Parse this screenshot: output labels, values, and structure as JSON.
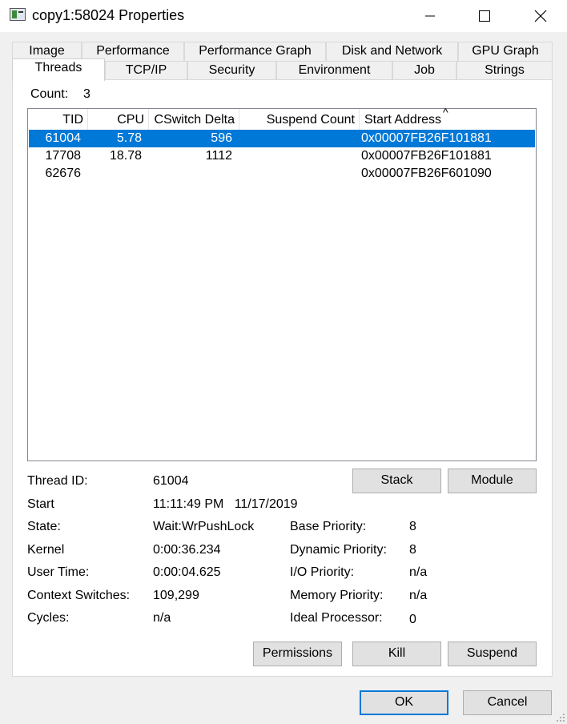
{
  "window": {
    "title": "copy1:58024 Properties"
  },
  "tabs_row1": [
    "Image",
    "Performance",
    "Performance Graph",
    "Disk and Network",
    "GPU Graph"
  ],
  "tabs_row2": [
    "Threads",
    "TCP/IP",
    "Security",
    "Environment",
    "Job",
    "Strings"
  ],
  "count": {
    "label": "Count:",
    "value": "3"
  },
  "threads": {
    "columns": [
      "TID",
      "CPU",
      "CSwitch Delta",
      "Suspend Count",
      "Start Address"
    ],
    "sort_indicator": "^",
    "rows": [
      {
        "tid": "61004",
        "cpu": "5.78",
        "cswitch": "596",
        "suspend": "",
        "start": "0x00007FB26F101881",
        "selected": true
      },
      {
        "tid": "17708",
        "cpu": "18.78",
        "cswitch": "1112",
        "suspend": "",
        "start": "0x00007FB26F101881",
        "selected": false
      },
      {
        "tid": "62676",
        "cpu": "",
        "cswitch": "",
        "suspend": "",
        "start": "0x00007FB26F601090",
        "selected": false
      }
    ]
  },
  "details": {
    "thread_id": {
      "label": "Thread ID:",
      "value": "61004"
    },
    "start": {
      "label": "Start",
      "value": "11:11:49 PM   11/17/2019"
    },
    "state": {
      "label": "State:",
      "value": "Wait:WrPushLock"
    },
    "kernel": {
      "label": "Kernel",
      "value": "0:00:36.234"
    },
    "user_time": {
      "label": "User Time:",
      "value": "0:00:04.625"
    },
    "context_switches": {
      "label": "Context Switches:",
      "value": "109,299"
    },
    "cycles": {
      "label": "Cycles:",
      "value": "n/a"
    },
    "base_priority": {
      "label": "Base Priority:",
      "value": "8"
    },
    "dynamic_priority": {
      "label": "Dynamic Priority:",
      "value": "8"
    },
    "io_priority": {
      "label": "I/O Priority:",
      "value": "n/a"
    },
    "memory_priority": {
      "label": "Memory Priority:",
      "value": "n/a"
    },
    "ideal_processor": {
      "label": "Ideal Processor:",
      "value": "0"
    }
  },
  "buttons": {
    "stack": "Stack",
    "module": "Module",
    "permissions": "Permissions",
    "kill": "Kill",
    "suspend": "Suspend",
    "ok": "OK",
    "cancel": "Cancel"
  },
  "colors": {
    "selection": "#0078d7",
    "panel": "#ffffff",
    "dialog": "#f0f0f0"
  }
}
